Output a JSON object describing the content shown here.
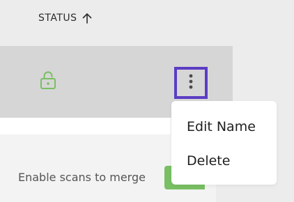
{
  "table": {
    "status_header": "STATUS",
    "sort_icon": "arrow-up-icon",
    "row": {
      "status_icon": "unlocked-lock-icon",
      "actions_icon": "vertical-ellipsis-icon"
    }
  },
  "menu": {
    "items": [
      {
        "label": "Edit Name"
      },
      {
        "label": "Delete"
      }
    ]
  },
  "merge_setting": {
    "label": "Enable scans to merge"
  },
  "colors": {
    "focus_border": "#5b3cc4",
    "status_green": "#79bf63",
    "row_highlight": "#d6d6d6",
    "page_background": "#ececec"
  }
}
